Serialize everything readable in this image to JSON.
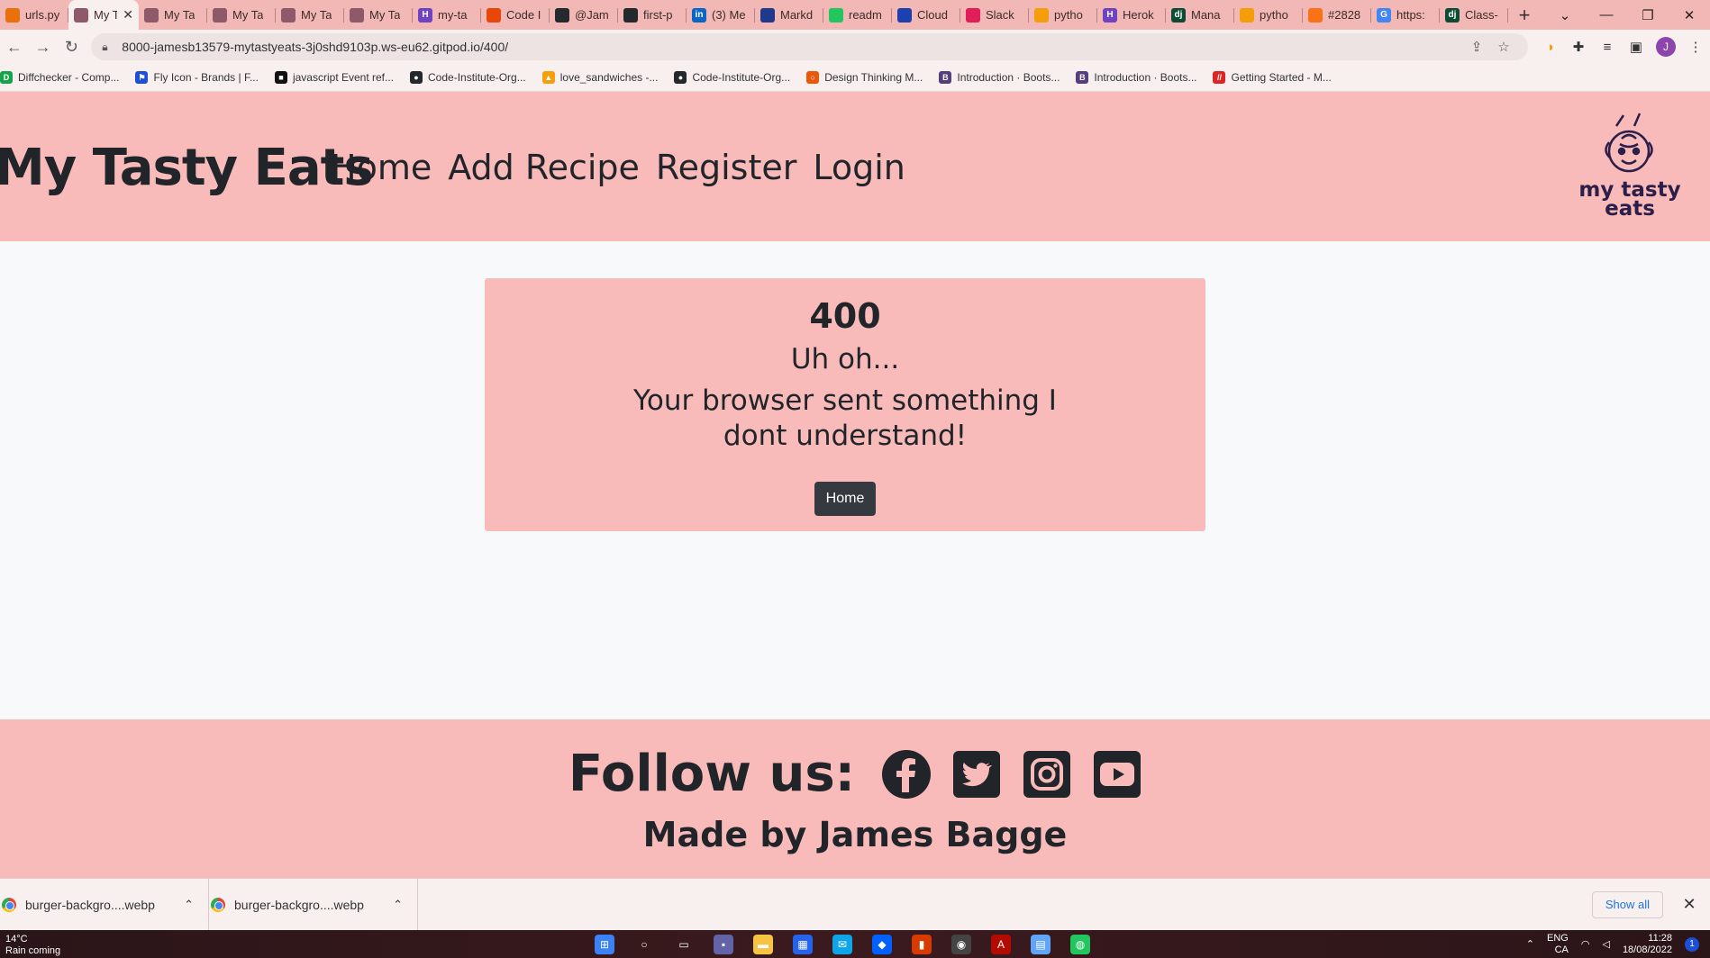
{
  "browser": {
    "tabs": [
      {
        "label": "urls.py",
        "color": "#e8710a",
        "glyph": ""
      },
      {
        "label": "My Tasty Eats",
        "color": "#8e5a6a",
        "glyph": "",
        "active": true
      },
      {
        "label": "My Ta",
        "color": "#8e5a6a",
        "glyph": ""
      },
      {
        "label": "My Ta",
        "color": "#8e5a6a",
        "glyph": ""
      },
      {
        "label": "My Ta",
        "color": "#8e5a6a",
        "glyph": ""
      },
      {
        "label": "My Ta",
        "color": "#8e5a6a",
        "glyph": ""
      },
      {
        "label": "my-ta",
        "color": "#6f42c1",
        "glyph": "H"
      },
      {
        "label": "Code I",
        "color": "#e8470a",
        "glyph": ""
      },
      {
        "label": "@Jam",
        "color": "#24292e",
        "glyph": ""
      },
      {
        "label": "first-p",
        "color": "#24292e",
        "glyph": ""
      },
      {
        "label": "(3) Me",
        "color": "#0a66c2",
        "glyph": "in"
      },
      {
        "label": "Markd",
        "color": "#1f3a8a",
        "glyph": ""
      },
      {
        "label": "readm",
        "color": "#22c55e",
        "glyph": ""
      },
      {
        "label": "Cloud",
        "color": "#1e40af",
        "glyph": ""
      },
      {
        "label": "Slack",
        "color": "#e01e5a",
        "glyph": ""
      },
      {
        "label": "pytho",
        "color": "#f59e0b",
        "glyph": ""
      },
      {
        "label": "Herok",
        "color": "#6f42c1",
        "glyph": "H"
      },
      {
        "label": "Mana",
        "color": "#0c4b33",
        "glyph": "dj"
      },
      {
        "label": "pytho",
        "color": "#f59e0b",
        "glyph": ""
      },
      {
        "label": "#2828",
        "color": "#f97316",
        "glyph": ""
      },
      {
        "label": "https:",
        "color": "#4285f4",
        "glyph": "G"
      },
      {
        "label": "Class-",
        "color": "#0c4b33",
        "glyph": "dj"
      }
    ],
    "url": "8000-jamesb13579-mytastyeats-3j0shd9103p.ws-eu62.gitpod.io/400/",
    "profile_initial": "J",
    "bookmarks": [
      {
        "label": "Diffchecker - Comp...",
        "color": "#16a34a",
        "glyph": "D"
      },
      {
        "label": "Fly Icon - Brands | F...",
        "color": "#1d4ed8",
        "glyph": "⚑"
      },
      {
        "label": "javascript Event ref...",
        "color": "#111111",
        "glyph": "■"
      },
      {
        "label": "Code-Institute-Org...",
        "color": "#24292e",
        "glyph": "●"
      },
      {
        "label": "love_sandwiches -...",
        "color": "#f59e0b",
        "glyph": "▲"
      },
      {
        "label": "Code-Institute-Org...",
        "color": "#24292e",
        "glyph": "●"
      },
      {
        "label": "Design Thinking M...",
        "color": "#ea580c",
        "glyph": "○"
      },
      {
        "label": "Introduction · Boots...",
        "color": "#563d7c",
        "glyph": "B"
      },
      {
        "label": "Introduction · Boots...",
        "color": "#563d7c",
        "glyph": "B"
      },
      {
        "label": "Getting Started - M...",
        "color": "#dc2626",
        "glyph": "//"
      }
    ]
  },
  "header": {
    "brand": "My Tasty Eats",
    "nav": [
      "Home",
      "Add Recipe",
      "Register",
      "Login"
    ],
    "logo_text_1": "my tasty",
    "logo_text_2": "eats"
  },
  "error": {
    "code": "400",
    "title": "Uh oh...",
    "message": "Your browser sent something I dont understand!",
    "button": "Home"
  },
  "footer": {
    "follow": "Follow us:",
    "social_icons": [
      "facebook-icon",
      "twitter-icon",
      "instagram-icon",
      "youtube-icon"
    ],
    "made_by": "Made by James Bagge"
  },
  "downloads": {
    "items": [
      "burger-backgro....webp",
      "burger-backgro....webp"
    ],
    "show_all": "Show all"
  },
  "taskbar": {
    "temperature": "14°C",
    "weather": "Rain coming",
    "language": "ENG",
    "region": "CA",
    "time": "11:28",
    "date": "18/08/2022",
    "notifications": "1"
  },
  "colors": {
    "header_bg": "#f8bbba",
    "text": "#212529",
    "button_bg": "#343a40",
    "page_bg": "#f8f9fa"
  }
}
